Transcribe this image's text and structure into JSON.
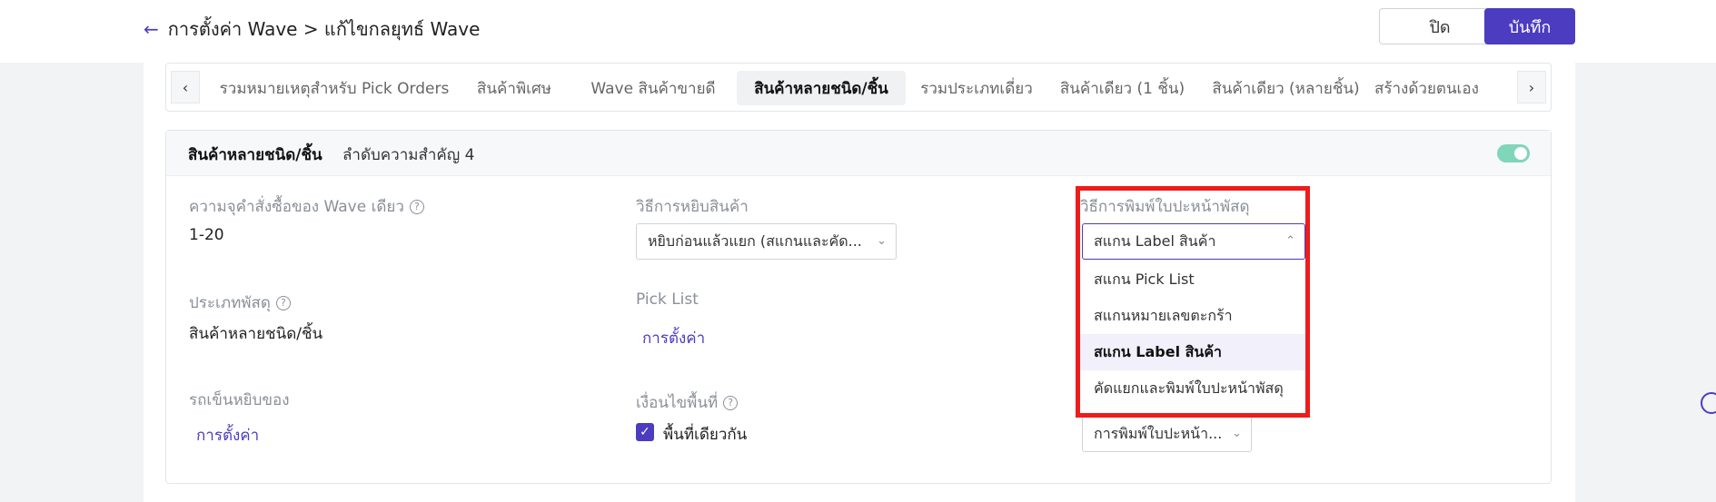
{
  "header": {
    "breadcrumb": "การตั้งค่า Wave > แก้ไขกลยุทธ์ Wave",
    "close_label": "ปิด",
    "save_label": "บันทึก"
  },
  "tabs": [
    {
      "label": "รวมหมายเหตุสำหรับ Pick Orders"
    },
    {
      "label": "สินค้าพิเศษ"
    },
    {
      "label": "Wave สินค้าขายดี"
    },
    {
      "label": "สินค้าหลายชนิด/ชิ้น"
    },
    {
      "label": "รวมประเภทเดี่ยว"
    },
    {
      "label": "สินค้าเดียว (1 ชิ้น)"
    },
    {
      "label": "สินค้าเดียว (หลายชิ้น)"
    },
    {
      "label": "สร้างด้วยตนเอง"
    }
  ],
  "card": {
    "title": "สินค้าหลายชนิด/ชิ้น",
    "priority": "ลำดับความสำคัญ 4",
    "capacity_label": "ความจุคำสั่งซื้อของ Wave เดียว",
    "capacity_value": "1-20",
    "pick_method_label": "วิธีการหยิบสินค้า",
    "pick_method_value": "หยิบก่อนแล้วแยก (สแกนและคัด...",
    "print_method_label": "วิธีการพิมพ์ใบปะหน้าพัสดุ",
    "print_method_value": "สแกน Label สินค้า",
    "parcel_type_label": "ประเภทพัสดุ",
    "parcel_type_value": "สินค้าหลายชนิด/ชิ้น",
    "pick_list_label": "Pick List",
    "pick_list_link": "การตั้งค่า",
    "cart_label": "รถเข็นหยิบของ",
    "cart_link": "การตั้งค่า",
    "area_label": "เงื่อนไขพื้นที่",
    "area_checkbox_label": "พื้นที่เดียวกัน",
    "bottom_select_value": "การพิมพ์ใบปะหน้า..."
  },
  "dropdown": {
    "options": [
      {
        "label": "สแกน Pick List"
      },
      {
        "label": "สแกนหมายเลขตะกร้า"
      },
      {
        "label": "สแกน Label สินค้า"
      },
      {
        "label": "คัดแยกและพิมพ์ใบปะหน้าพัสดุ"
      }
    ],
    "selected": "สแกน Label สินค้า"
  },
  "colors": {
    "accent": "#4b3cc0",
    "toggle_on": "#7fd6b9",
    "highlight_box": "#ee1c1c"
  }
}
